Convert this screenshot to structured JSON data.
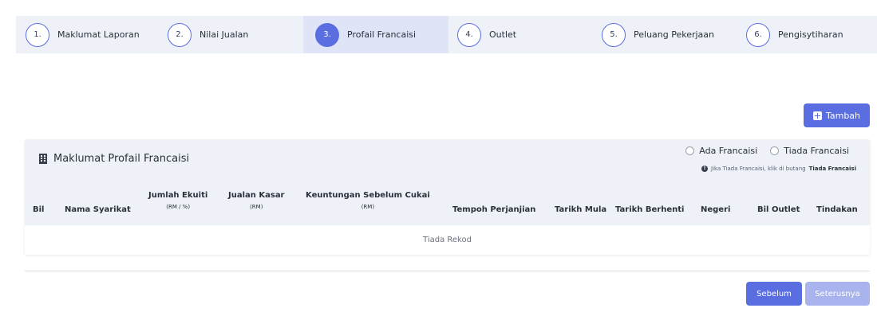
{
  "steps": [
    {
      "num": "1.",
      "label": "Maklumat Laporan"
    },
    {
      "num": "2.",
      "label": "Nilai Jualan"
    },
    {
      "num": "3.",
      "label": "Profail Francaisi"
    },
    {
      "num": "4.",
      "label": "Outlet"
    },
    {
      "num": "5.",
      "label": "Peluang Pekerjaan"
    },
    {
      "num": "6.",
      "label": "Pengisytiharan"
    }
  ],
  "active_step": 3,
  "add_button": "Tambah",
  "card": {
    "title": "Maklumat Profail Francaisi",
    "radio_ada": "Ada Francaisi",
    "radio_tiada": "Tiada Francaisi",
    "hint_prefix": "Jika Tiada Francaisi, klik di butang",
    "hint_bold": "Tiada Francaisi"
  },
  "table": {
    "headers": {
      "bil": "Bil",
      "nama": "Nama Syarikat",
      "ekuiti": "Jumlah Ekuiti",
      "ekuiti_sub": "(RM / %)",
      "jualan": "Jualan Kasar",
      "jualan_sub": "(RM)",
      "untung": "Keuntungan Sebelum Cukai",
      "untung_sub": "(RM)",
      "tempoh": "Tempoh Perjanjian",
      "mula": "Tarikh Mula",
      "berhenti": "Tarikh Berhenti",
      "negeri": "Negeri",
      "outlet": "Bil Outlet",
      "tindakan": "Tindakan"
    },
    "empty_text": "Tiada Rekod"
  },
  "nav": {
    "prev": "Sebelum",
    "next": "Seterusnya"
  },
  "colors": {
    "accent": "#5b6ee1",
    "accent_disabled": "#a9b4ee",
    "header_bg": "#eef1f8"
  }
}
